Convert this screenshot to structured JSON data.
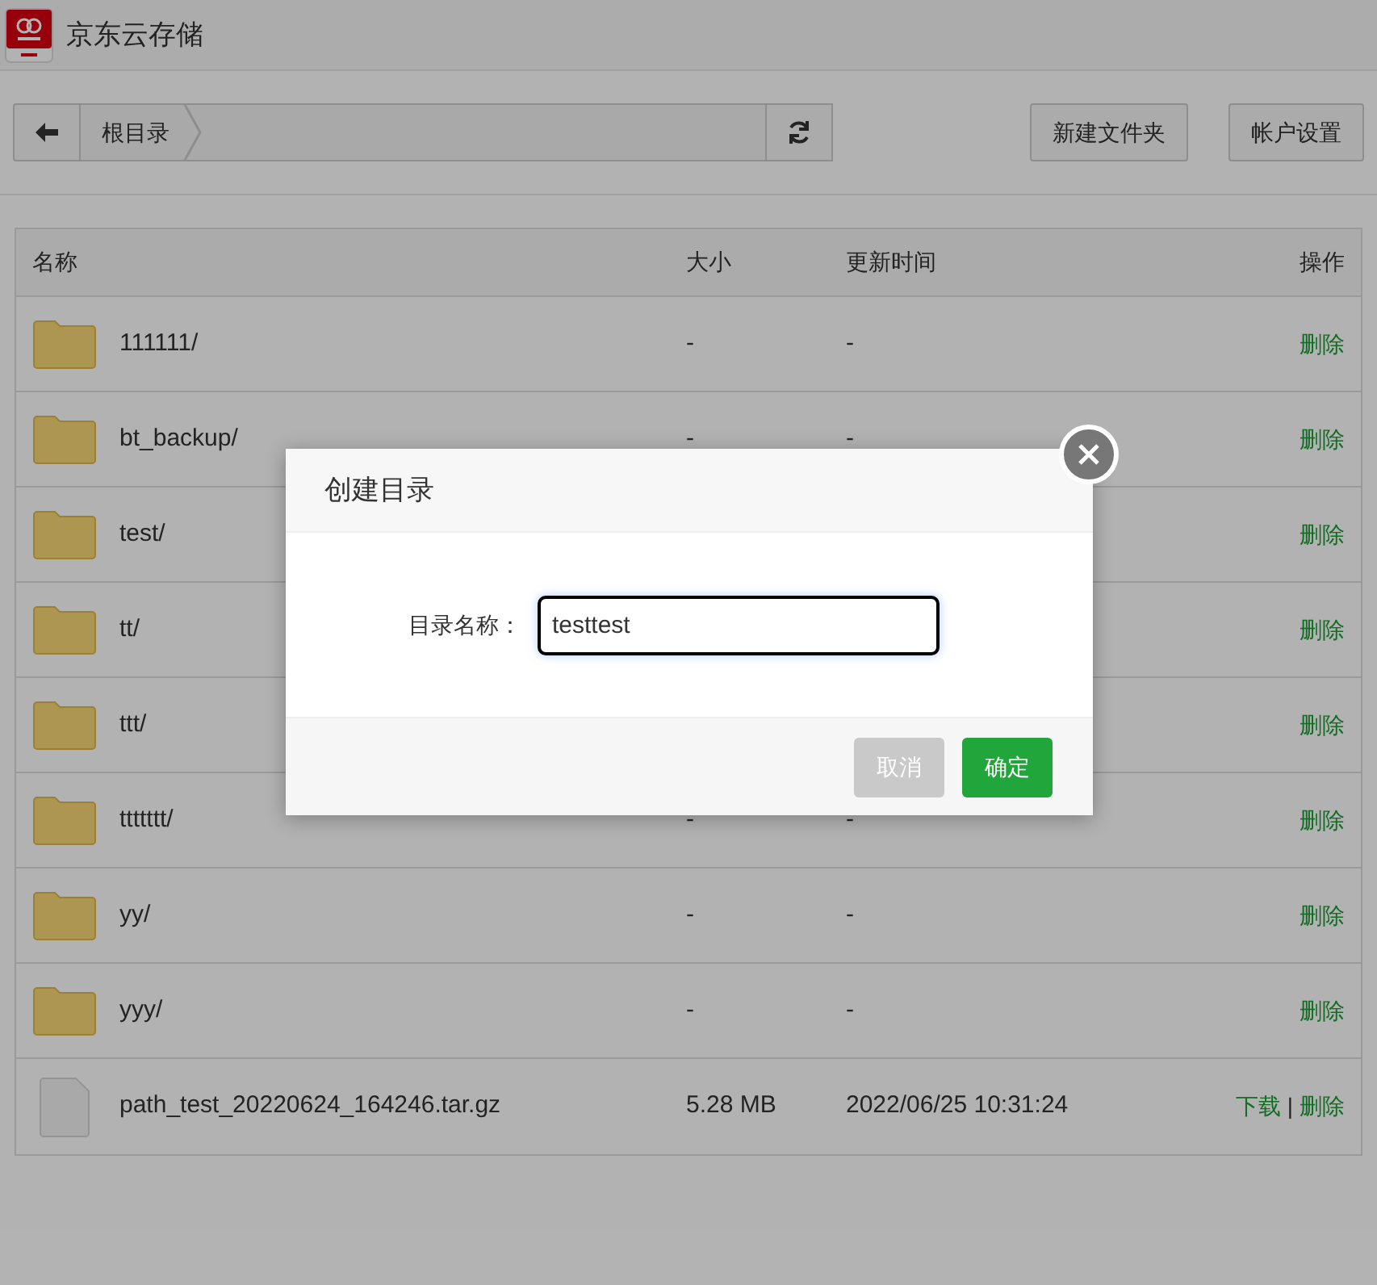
{
  "app": {
    "title": "京东云存储"
  },
  "toolbar": {
    "breadcrumb": "根目录",
    "buttons": [
      "新建文件夹",
      "帐户设置"
    ]
  },
  "table": {
    "columns": [
      "名称",
      "大小",
      "更新时间",
      "操作"
    ],
    "rows": [
      {
        "kind": "folder",
        "name": "111111/",
        "size": "-",
        "updated": "-",
        "actions": [
          "删除"
        ]
      },
      {
        "kind": "folder",
        "name": "bt_backup/",
        "size": "-",
        "updated": "-",
        "actions": [
          "删除"
        ]
      },
      {
        "kind": "folder",
        "name": "test/",
        "actions": [
          "删除"
        ]
      },
      {
        "kind": "folder",
        "name": "tt/",
        "actions": [
          "删除"
        ]
      },
      {
        "kind": "folder",
        "name": "ttt/",
        "actions": [
          "删除"
        ]
      },
      {
        "kind": "folder",
        "name": "ttttttt/",
        "size": "-",
        "updated": "-",
        "actions": [
          "删除"
        ]
      },
      {
        "kind": "folder",
        "name": "yy/",
        "size": "-",
        "updated": "-",
        "actions": [
          "删除"
        ]
      },
      {
        "kind": "folder",
        "name": "yyy/",
        "size": "-",
        "updated": "-",
        "actions": [
          "删除"
        ]
      },
      {
        "kind": "file",
        "name": "path_test_20220624_164246.tar.gz",
        "size": "5.28 MB",
        "updated": "2022/06/25 10:31:24",
        "actions": [
          "下载",
          "删除"
        ],
        "separator": "|"
      }
    ]
  },
  "dialog": {
    "title": "创建目录",
    "field_label": "目录名称：",
    "value": "testtest",
    "buttons": [
      {
        "label": "取消",
        "kind": "cancel"
      },
      {
        "label": "确定",
        "kind": "primary"
      }
    ]
  }
}
